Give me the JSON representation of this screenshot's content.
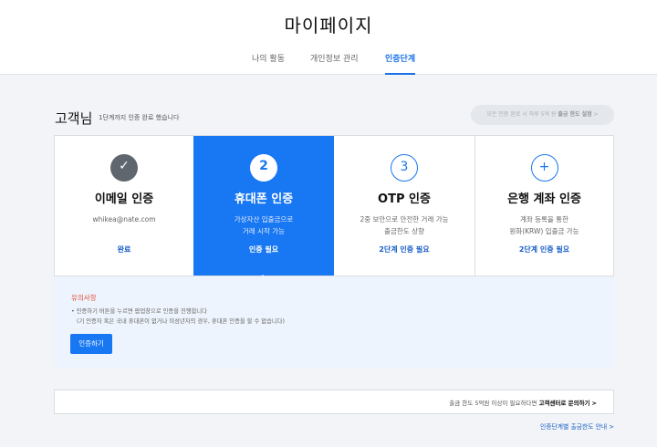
{
  "header": {
    "title": "마이페이지"
  },
  "tabs": [
    {
      "label": "나의 활동",
      "active": false
    },
    {
      "label": "개인정보 관리",
      "active": false
    },
    {
      "label": "인증단계",
      "active": true
    }
  ],
  "greeting": {
    "name": "고객님",
    "subtitle": "1단계까지 인증 완료 했습니다",
    "notice_prefix": "모든 인증 완료 시 하루 5억 원 ",
    "notice_bold": "출금 한도 설정",
    "notice_arrow": ">"
  },
  "steps": [
    {
      "icon": "check-icon",
      "icon_text": "✓",
      "title": "이메일 인증",
      "desc_line1": "whikea@nate.com",
      "desc_line2": "",
      "status": "완료"
    },
    {
      "icon": "number-2-icon",
      "icon_text": "2",
      "title": "휴대폰 인증",
      "desc_line1": "가상자산 입출금으로",
      "desc_line2": "거래 시작 가능",
      "status": "인증 필요"
    },
    {
      "icon": "number-3-icon",
      "icon_text": "3",
      "title": "OTP 인증",
      "desc_line1": "2중 보안으로 안전한 거래 가능",
      "desc_line2": "출금한도 상향",
      "status": "2단계 인증 필요"
    },
    {
      "icon": "plus-icon",
      "icon_text": "+",
      "title": "은행 계좌 인증",
      "desc_line1": "계좌 등록을 통한",
      "desc_line2": "원화(KRW) 입출금 가능",
      "status": "2단계 인증 필요"
    }
  ],
  "notice": {
    "title": "유의사항",
    "line1": "• 인증하기 버튼을 누르면 팝업창으로 인증을 진행합니다",
    "line2": "(기 인증자 혹은 국내 휴대폰이 없거나 미성년자의 경우, 휴대폰 인증을 할 수 없습니다)",
    "button": "인증하기"
  },
  "footer": {
    "contact_prefix": "출금 한도 5억원 이상이 필요하다면 ",
    "contact_bold": "고객센터로 문의하기",
    "contact_arrow": ">",
    "guide_link": "인증단계별 출금한도 안내 >"
  },
  "colors": {
    "accent": "#1877f2",
    "warning": "#e04f3a",
    "done_icon": "#5f666e"
  }
}
